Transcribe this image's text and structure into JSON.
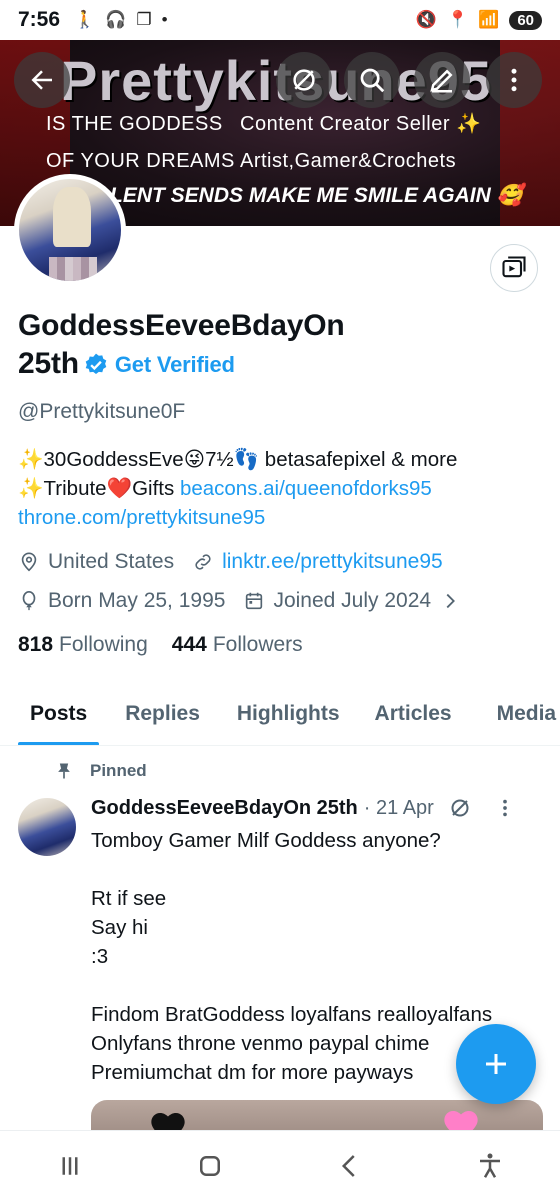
{
  "status_bar": {
    "time": "7:56",
    "battery": "60"
  },
  "banner": {
    "title": "Prettykitsune95",
    "line_left_1": "IS THE GODDESS",
    "line_right_1": "Content Creator Seller ✨",
    "line_left_2": "OF YOUR DREAMS",
    "line_right_2": "Artist,Gamer&Crochets",
    "shout": "LENT SENDS MAKE ME SMILE AGAIN",
    "shout_emoji": "🥰"
  },
  "profile": {
    "display_name": "GoddessEeveeBdayOn 25th",
    "get_verified": "Get Verified",
    "handle": "@Prettykitsune0F",
    "bio_line1": "✨30GoddessEve😜7½👣 betasafepixel & more",
    "bio_line2_text": "✨Tribute❤️Gifts ",
    "bio_link1": "beacons.ai/queenofdorks95",
    "bio_link2": "throne.com/prettykitsune95",
    "location": "United States",
    "website": "linktr.ee/prettykitsune95",
    "birthday": "Born May 25, 1995",
    "joined": "Joined July 2024",
    "following_count": "818",
    "following_label": "Following",
    "followers_count": "444",
    "followers_label": "Followers"
  },
  "tabs": [
    "Posts",
    "Replies",
    "Highlights",
    "Articles",
    "Media"
  ],
  "post": {
    "pinned_label": "Pinned",
    "author": "GoddessEeveeBdayOn 25th",
    "date": "· 21 Apr",
    "text": "Tomboy Gamer Milf Goddess  anyone?\n\nRt if see\nSay  hi\n:3\n\nFindom BratGoddess  loyalfans realloyalfans\nOnlyfans  throne venmo  paypal  chime\nPremiumchat  dm for more payways"
  },
  "colors": {
    "accent": "#1d9bf0",
    "secondary_text": "#536471",
    "text": "#0f1419"
  },
  "icons": {
    "back": "arrow-left-icon",
    "grok": "grok-icon",
    "search": "search-icon",
    "edit": "pencil-icon",
    "more": "more-vertical-icon",
    "media": "media-gallery-icon",
    "location": "location-pin-icon",
    "link": "link-icon",
    "birthday": "balloon-icon",
    "calendar": "calendar-icon",
    "pin": "pin-icon",
    "compose": "plus-icon"
  }
}
